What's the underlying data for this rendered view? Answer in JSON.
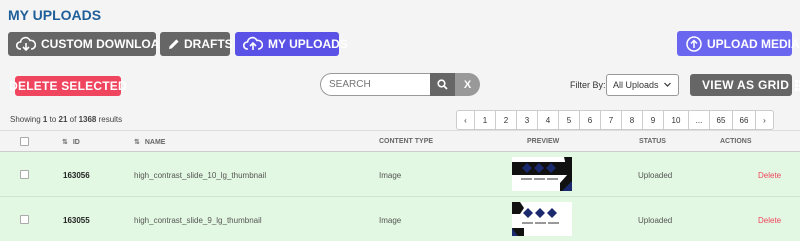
{
  "page": {
    "title": "MY UPLOADS"
  },
  "tabs": [
    {
      "label": "CUSTOM DOWNLOADS",
      "icon": "cloud-download-icon"
    },
    {
      "label": "DRAFTS",
      "icon": "pencil-icon"
    },
    {
      "label": "MY UPLOADS",
      "icon": "cloud-upload-icon",
      "active": true
    }
  ],
  "actions": {
    "upload_media": "UPLOAD MEDIA",
    "delete_selected": "DELETE SELECTED",
    "view_as_grid": "VIEW AS GRID"
  },
  "search": {
    "placeholder": "SEARCH",
    "value": "",
    "clear_label": "X"
  },
  "filter": {
    "label": "Filter By:",
    "selected": "All Uploads"
  },
  "results": {
    "prefix": "Showing",
    "from": "1",
    "to": "21",
    "of_word": "of",
    "total": "1368",
    "suffix": "results"
  },
  "pagination": {
    "prev": "‹",
    "pages": [
      "1",
      "2",
      "3",
      "4",
      "5",
      "6",
      "7",
      "8",
      "9",
      "10",
      "...",
      "65",
      "66"
    ],
    "next": "›"
  },
  "table": {
    "sort_glyph": "⇅",
    "columns": {
      "id": "ID",
      "name": "NAME",
      "content_type": "CONTENT TYPE",
      "preview": "PREVIEW",
      "status": "STATUS",
      "actions": "ACTIONS"
    },
    "rows": [
      {
        "id": "163056",
        "name": "high_contrast_slide_10_lg_thumbnail",
        "content_type": "Image",
        "status": "Uploaded",
        "action": "Delete"
      },
      {
        "id": "163055",
        "name": "high_contrast_slide_9_lg_thumbnail",
        "content_type": "Image",
        "status": "Uploaded",
        "action": "Delete"
      }
    ]
  },
  "colors": {
    "title": "#1f5f99",
    "tab_gray": "#666666",
    "tab_active": "#5a52e6",
    "upload_button": "#6a66f0",
    "delete_button": "#f0455e",
    "row_background": "#e2f8e2",
    "thumbnail_navy": "#1a2a6c",
    "thumbnail_black": "#111111"
  }
}
